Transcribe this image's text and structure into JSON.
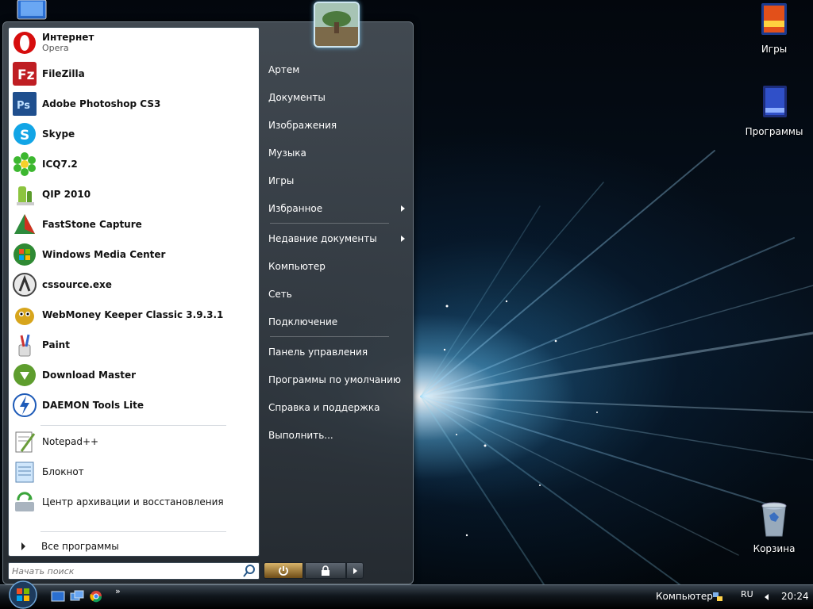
{
  "desktop": {
    "icons": [
      {
        "label": "Игры",
        "icon": "games-folder-icon"
      },
      {
        "label": "Программы",
        "icon": "programs-folder-icon"
      },
      {
        "label": "Корзина",
        "icon": "recycle-bin-icon"
      }
    ]
  },
  "start_menu": {
    "pinned": [
      {
        "label": "Интернет",
        "sub": "Opera",
        "icon": "opera-icon"
      },
      {
        "label": "FileZilla",
        "icon": "filezilla-icon"
      },
      {
        "label": "Adobe Photoshop CS3",
        "icon": "photoshop-icon"
      },
      {
        "label": "Skype",
        "icon": "skype-icon"
      },
      {
        "label": "ICQ7.2",
        "icon": "icq-icon"
      },
      {
        "label": "QIP 2010",
        "icon": "qip-icon"
      },
      {
        "label": "FastStone Capture",
        "icon": "faststone-icon"
      },
      {
        "label": "Windows Media Center",
        "icon": "media-center-icon"
      },
      {
        "label": "cssource.exe",
        "icon": "cssource-icon"
      },
      {
        "label": "WebMoney Keeper Classic 3.9.3.1",
        "icon": "webmoney-icon"
      },
      {
        "label": "Paint",
        "icon": "paint-icon"
      },
      {
        "label": "Download Master",
        "icon": "download-master-icon"
      },
      {
        "label": "DAEMON Tools Lite",
        "icon": "daemon-tools-icon"
      }
    ],
    "recent": [
      {
        "label": "Notepad++",
        "icon": "notepadpp-icon"
      },
      {
        "label": "Блокнот",
        "icon": "notepad-icon"
      },
      {
        "label": "Центр архивации и восстановления",
        "icon": "backup-center-icon"
      }
    ],
    "all_programs_label": "Все программы",
    "search_placeholder": "Начать поиск",
    "right_items": [
      {
        "label": "Артем"
      },
      {
        "label": "Документы"
      },
      {
        "label": "Изображения"
      },
      {
        "label": "Музыка"
      },
      {
        "label": "Игры"
      },
      {
        "label": "Избранное",
        "submenu": true
      },
      {
        "label": "Недавние документы",
        "submenu": true
      },
      {
        "label": "Компьютер"
      },
      {
        "label": "Сеть"
      },
      {
        "label": "Подключение"
      },
      {
        "label": "Панель управления"
      },
      {
        "label": "Программы по умолчанию"
      },
      {
        "label": "Справка и поддержка"
      },
      {
        "label": "Выполнить..."
      }
    ]
  },
  "taskbar": {
    "quick_launch_more": "»",
    "computer_label": "Компьютер",
    "language": "RU",
    "clock": "20:24"
  }
}
